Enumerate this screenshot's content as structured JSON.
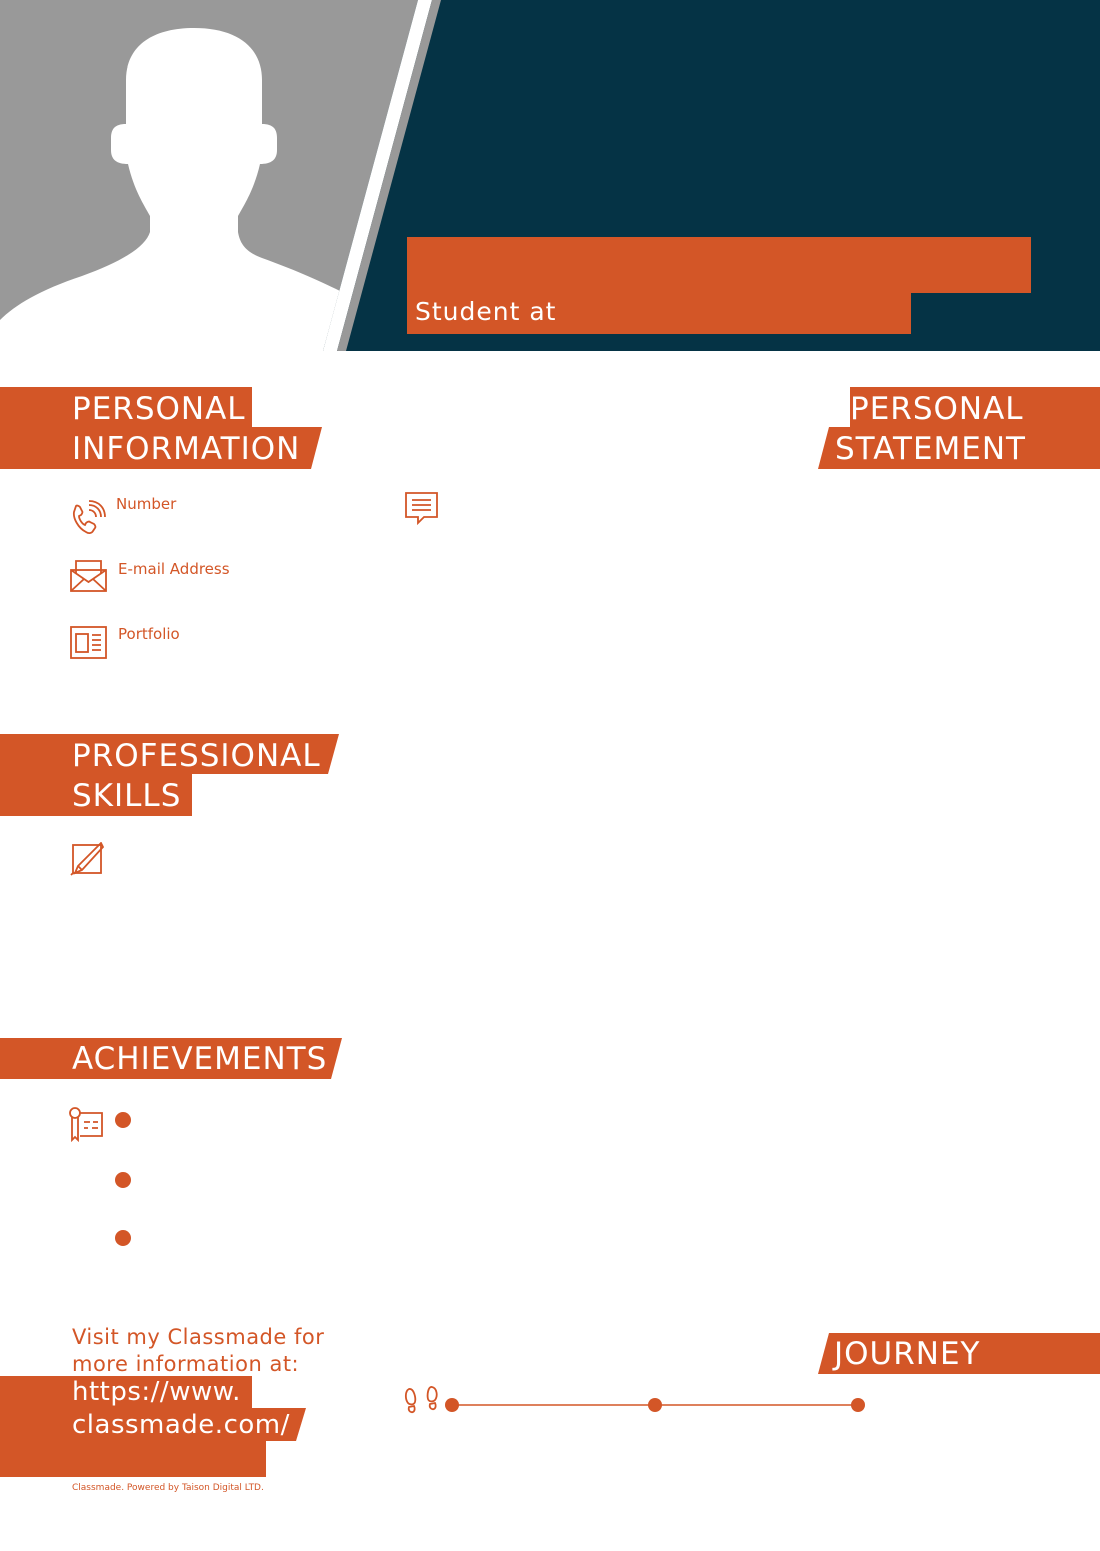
{
  "header": {
    "name": "",
    "subtitle": "Student at",
    "colors": {
      "navy": "#053345",
      "orange": "#d35627",
      "gray": "#999999"
    }
  },
  "personal_information": {
    "heading_line1": "PERSONAL",
    "heading_line2": "INFORMATION",
    "items": [
      {
        "label": "Number",
        "icon": "phone-icon"
      },
      {
        "label": "E-mail Address",
        "icon": "envelope-icon"
      },
      {
        "label": "Portfolio",
        "icon": "portfolio-icon"
      }
    ]
  },
  "personal_statement": {
    "heading_line1": "PERSONAL",
    "heading_line2": "STATEMENT",
    "icon": "comment-icon"
  },
  "professional_skills": {
    "heading_line1": "PROFESSIONAL",
    "heading_line2": "SKILLS",
    "icon": "pencil-icon"
  },
  "achievements": {
    "heading": "ACHIEVEMENTS",
    "icon": "certificate-icon",
    "bullets": 3
  },
  "journey": {
    "heading": "JOURNEY",
    "icon": "footprints-icon",
    "points": 3
  },
  "footer": {
    "promo_line1": "Visit my Classmade for",
    "promo_line2": "more information at:",
    "url_line1": "https://www.",
    "url_line2": "classmade.com/",
    "credit": "Classmade. Powered by Taison Digital LTD."
  }
}
